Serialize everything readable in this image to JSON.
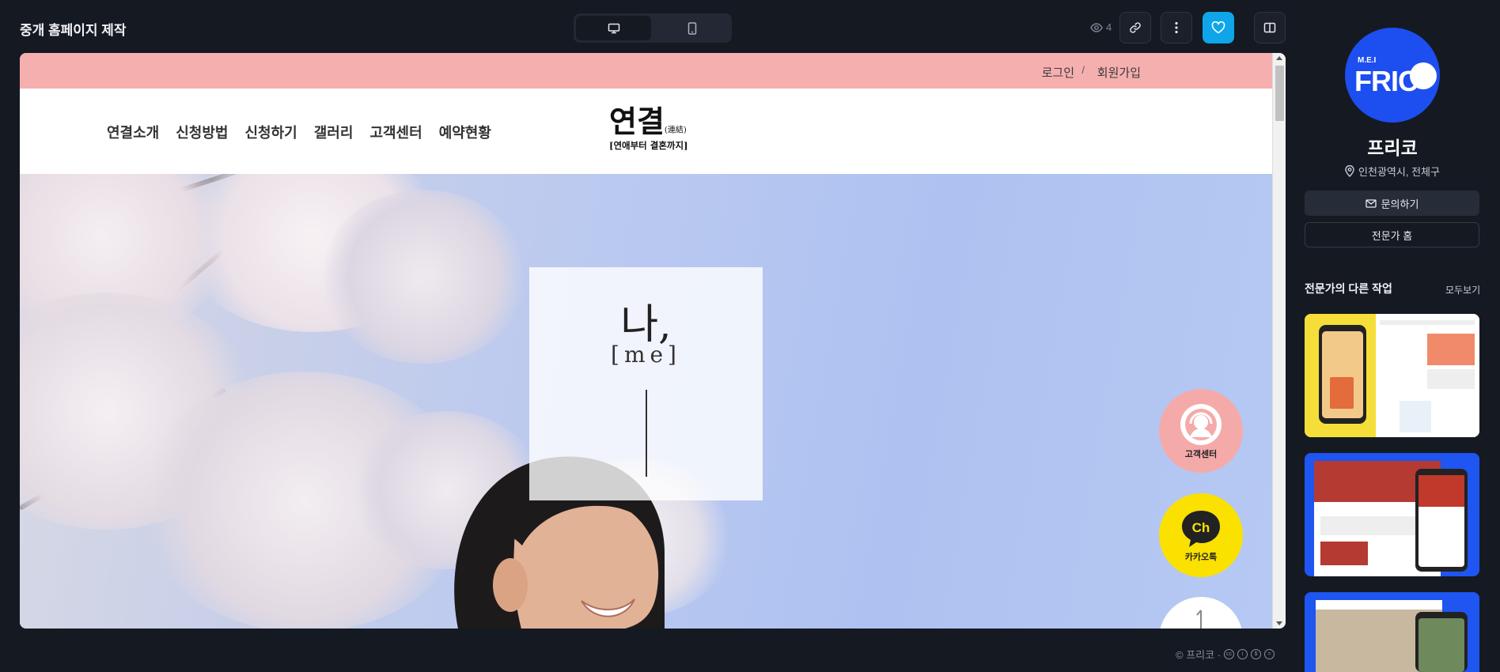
{
  "header": {
    "title": "중개 홈페이지 제작",
    "views": "4",
    "device_toggle": {
      "desktop": "monitor-icon",
      "mobile": "phone-icon",
      "selected": "desktop"
    },
    "actions": [
      "link-icon",
      "more-vertical-icon",
      "heart-icon",
      "sidebar-toggle-icon"
    ]
  },
  "preview": {
    "promo_bar": {
      "login": "로그인",
      "separator": "/",
      "join": "회원가입",
      "color": "#f6afaf"
    },
    "nav": [
      "연결소개",
      "신청방법",
      "신청하기",
      "갤러리",
      "고객센터",
      "예약현황"
    ],
    "logo": {
      "main": "연결",
      "hanja": "(連結)",
      "tagline": "[연애부터 결혼까지]"
    },
    "hero": {
      "word": "나,",
      "romanization": "[me]"
    },
    "floating": {
      "customer_center": "고객센터",
      "kakao": "카카오톡",
      "kakao_badge": "Ch"
    }
  },
  "footer": {
    "credit": "© 프리코 ·"
  },
  "sidebar": {
    "avatar": {
      "small": "M.E.I",
      "large": "FRIC",
      "color": "#1d4ef0"
    },
    "name": "프리코",
    "location": "인천광역시, 전체구",
    "contact_button": "문의하기",
    "home_button": "전문가 홈",
    "works_title": "전문가의 다른 작업",
    "works_more": "모두보기"
  },
  "colors": {
    "accent": "#0ea5e9",
    "background": "#151922"
  }
}
